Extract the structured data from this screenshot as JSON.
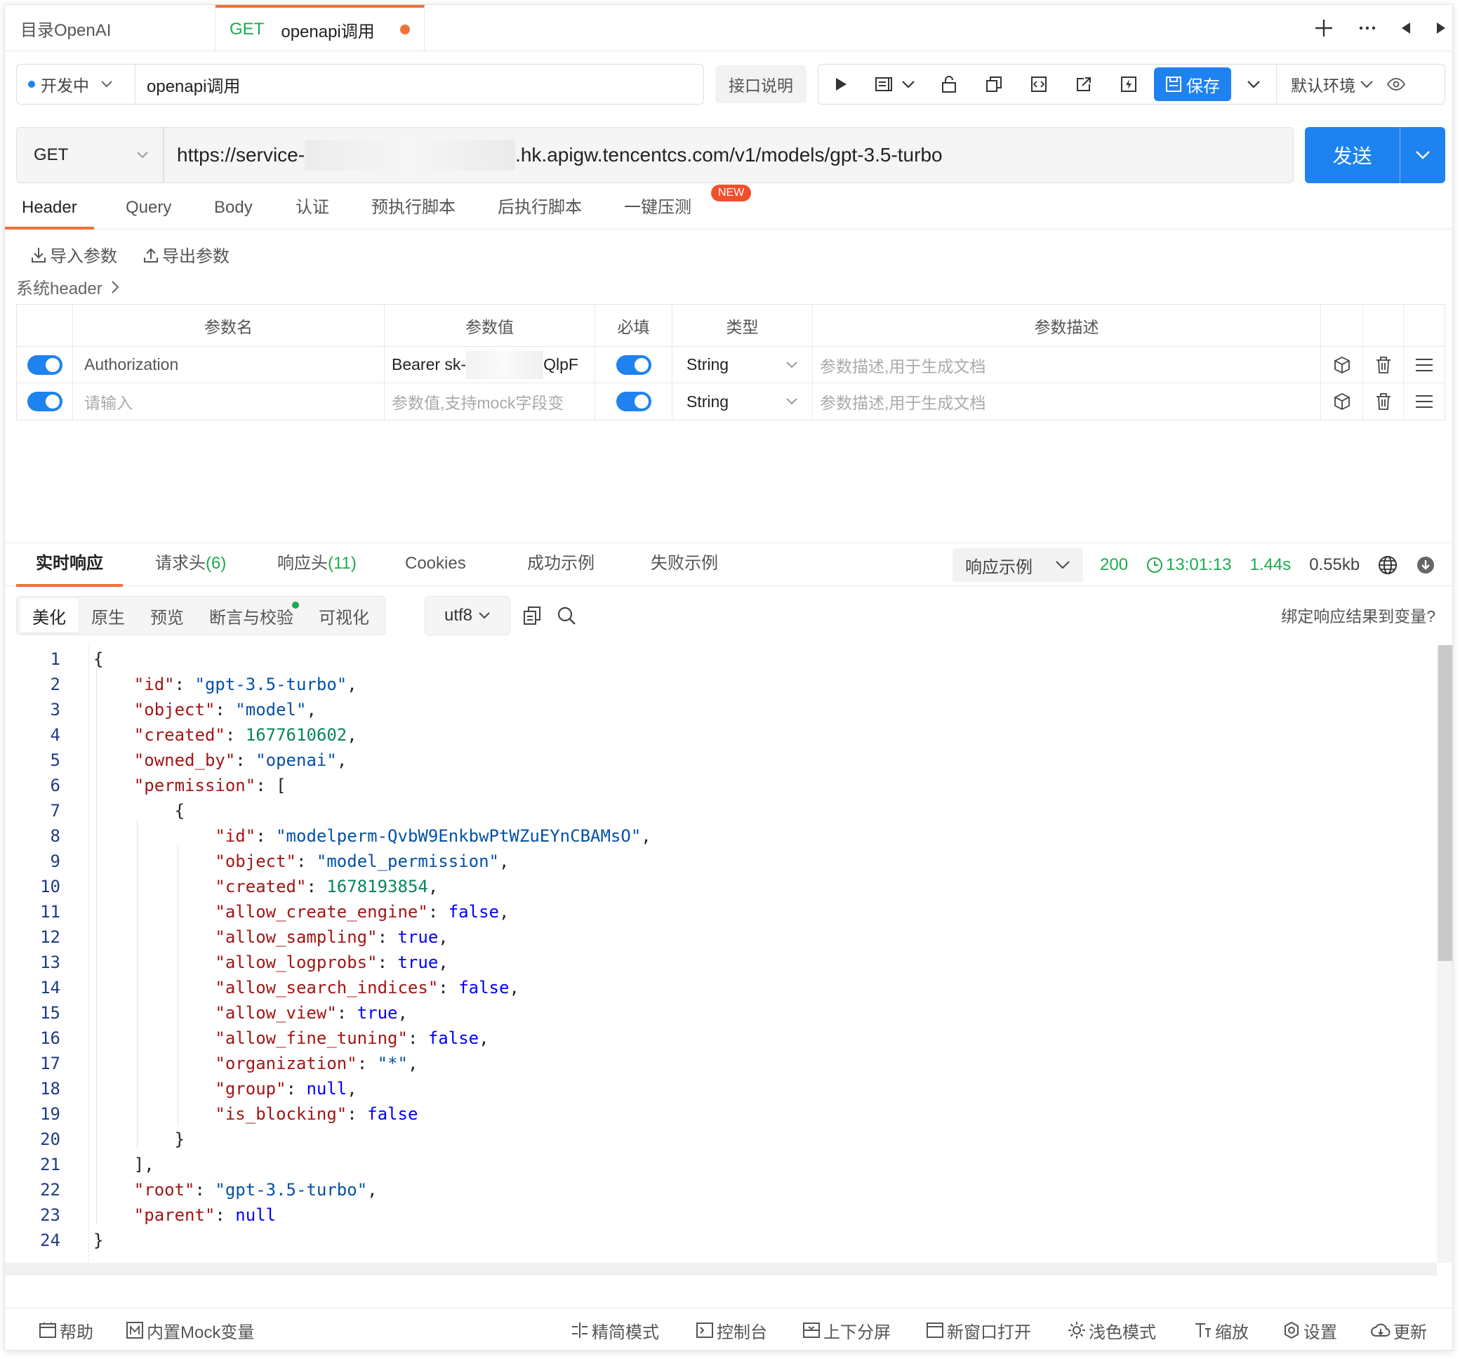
{
  "tabs": {
    "directory": "目录OpenAI",
    "active_method": "GET",
    "active_name": "openapi调用"
  },
  "request": {
    "status": "开发中",
    "name": "openapi调用",
    "doc_button": "接口说明",
    "save_label": "保存",
    "environment": "默认环境",
    "method": "GET",
    "url_prefix": "https://service-",
    "url_suffix": ".hk.apigw.tencentcs.com/v1/models/gpt-3.5-turbo",
    "send_label": "发送"
  },
  "req_tabs": [
    "Header",
    "Query",
    "Body",
    "认证",
    "预执行脚本",
    "后执行脚本",
    "一键压测"
  ],
  "new_badge": "NEW",
  "import_label": "导入参数",
  "export_label": "导出参数",
  "system_header": "系统header",
  "param_table": {
    "headers": [
      "参数名",
      "参数值",
      "必填",
      "类型",
      "参数描述"
    ],
    "rows": [
      {
        "name": "Authorization",
        "value": "Bearer sk-",
        "value_tail": "QlpF",
        "type": "String",
        "desc_placeholder": "参数描述,用于生成文档"
      },
      {
        "name_placeholder": "请输入",
        "value_placeholder": "参数值,支持mock字段变",
        "type": "String",
        "desc_placeholder": "参数描述,用于生成文档"
      }
    ]
  },
  "response_tabs": {
    "realtime": "实时响应",
    "req_headers": "请求头",
    "req_headers_count": "(6)",
    "resp_headers": "响应头",
    "resp_headers_count": "(11)",
    "cookies": "Cookies",
    "success": "成功示例",
    "fail": "失败示例"
  },
  "response_sample": "响应示例",
  "response_meta": {
    "status": "200",
    "time": "13:01:13",
    "duration": "1.44s",
    "size": "0.55kb"
  },
  "view_modes": [
    "美化",
    "原生",
    "预览",
    "断言与校验",
    "可视化"
  ],
  "encoding": "utf8",
  "bind_link": "绑定响应结果到变量?",
  "code_lines": [
    "1",
    "2",
    "3",
    "4",
    "5",
    "6",
    "7",
    "8",
    "9",
    "10",
    "11",
    "12",
    "13",
    "14",
    "15",
    "16",
    "17",
    "18",
    "19",
    "20",
    "21",
    "22",
    "23",
    "24"
  ],
  "json_response": {
    "id": "gpt-3.5-turbo",
    "object": "model",
    "created": "1677610602",
    "owned_by": "openai",
    "perm_id": "modelperm-QvbW9EnkbwPtWZuEYnCBAMsO",
    "perm_object": "model_permission",
    "perm_created": "1678193854",
    "allow_create_engine": "false",
    "allow_sampling": "true",
    "allow_logprobs": "true",
    "allow_search_indices": "false",
    "allow_view": "true",
    "allow_fine_tuning": "false",
    "organization": "*",
    "group": "null",
    "is_blocking": "false",
    "root": "gpt-3.5-turbo",
    "parent": "null"
  },
  "footer": [
    "帮助",
    "内置Mock变量",
    "精简模式",
    "控制台",
    "上下分屏",
    "新窗口打开",
    "浅色模式",
    "缩放",
    "设置",
    "更新"
  ],
  "colors": {
    "accent": "#1e82f0",
    "tab_indicator": "#f0713c",
    "success": "#1daa4e",
    "json_key": "#a31515",
    "json_string": "#0451a5",
    "json_number": "#098658"
  }
}
